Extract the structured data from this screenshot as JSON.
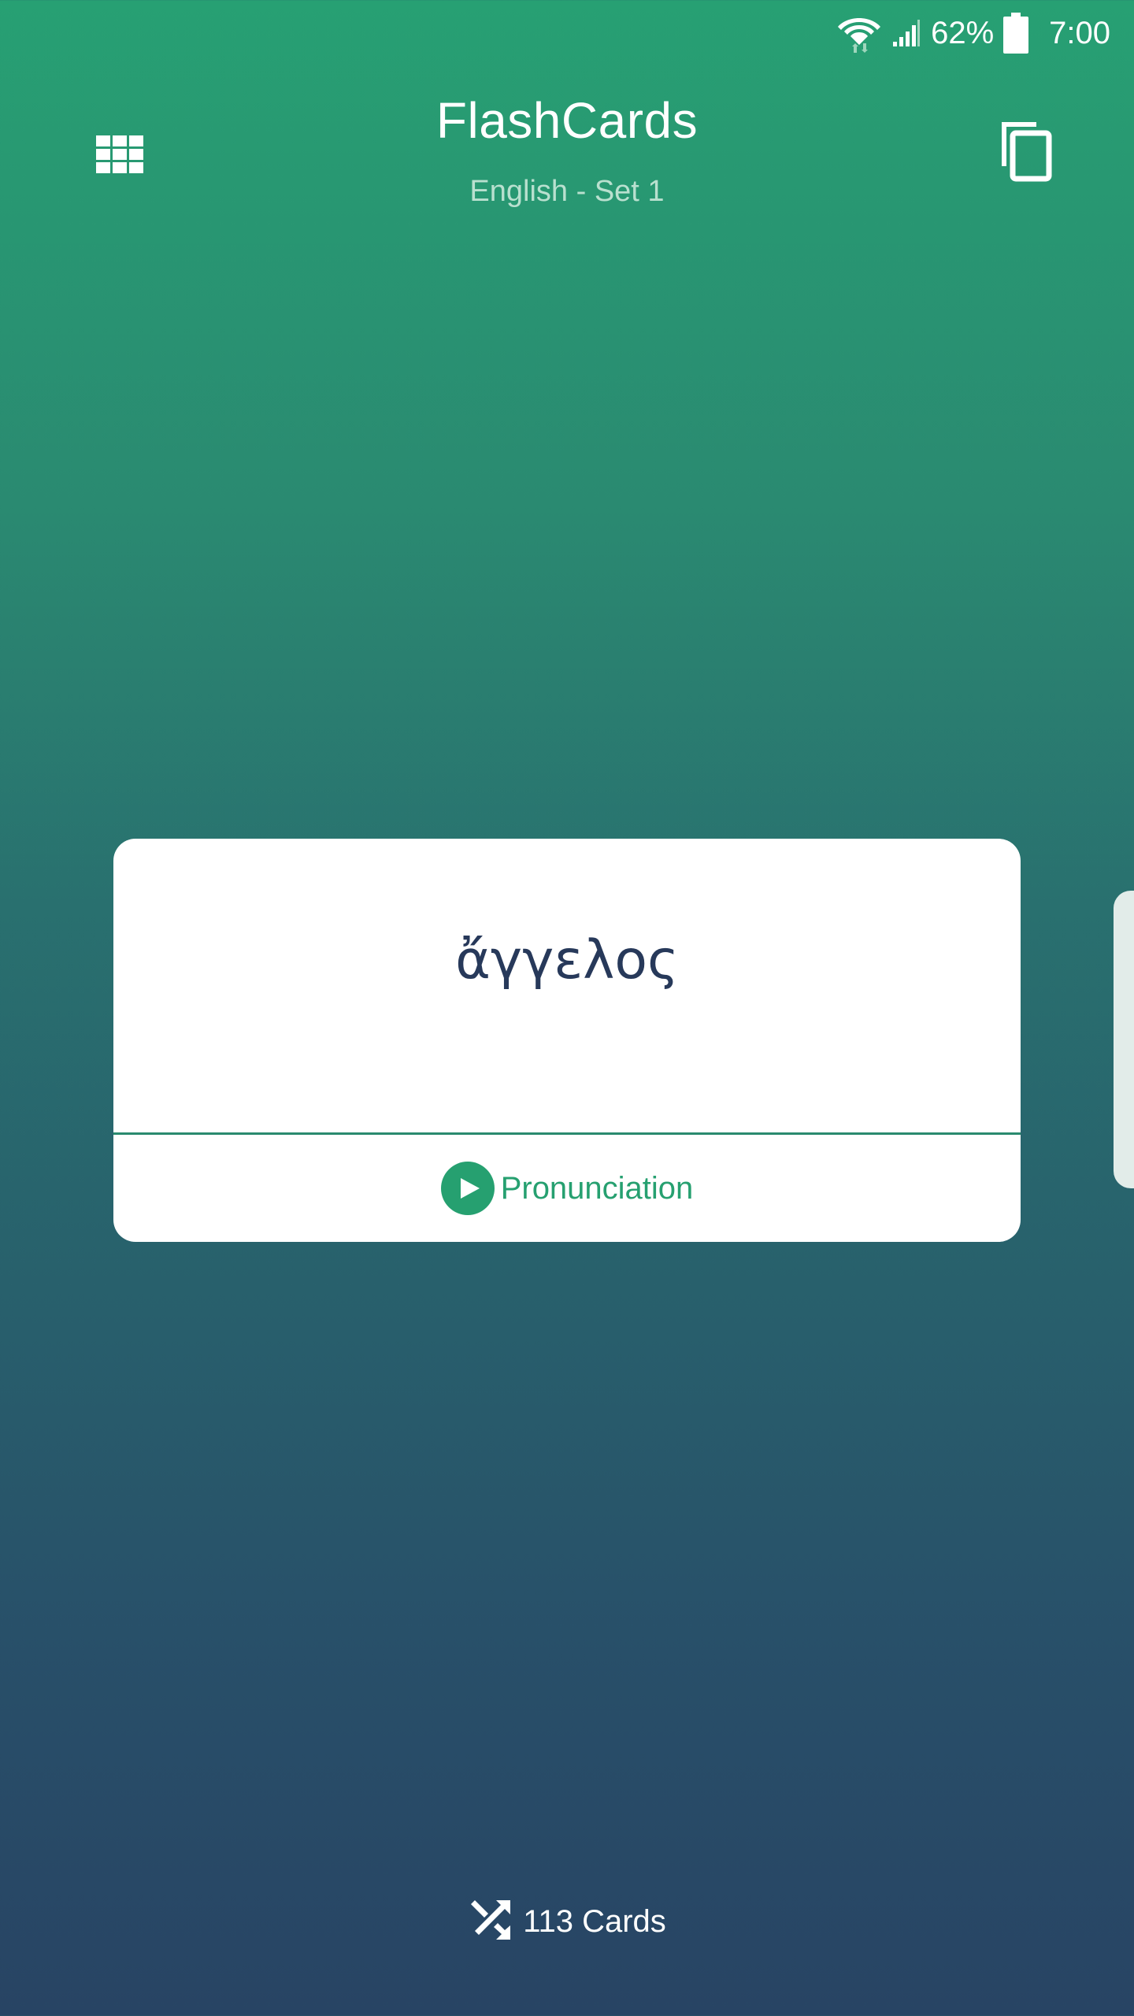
{
  "status_bar": {
    "battery_percent": "62%",
    "time": "7:00",
    "wifi_icon": "wifi-icon",
    "signal_icon": "signal-icon",
    "battery_icon": "battery-icon"
  },
  "header": {
    "title": "FlashCards",
    "subtitle": "English - Set 1",
    "left_icon": "grid-icon",
    "right_icon": "copy-icon"
  },
  "card": {
    "word": "ἄγγελος",
    "pronunciation_label": "Pronunciation",
    "pronunciation_icon": "play-icon"
  },
  "footer": {
    "shuffle_icon": "shuffle-icon",
    "card_count_label": "113 Cards"
  },
  "colors": {
    "accent": "#26a070",
    "gradient_top": "#27a073",
    "gradient_bottom": "#284464",
    "card_text": "#27395a",
    "subtitle": "#b9e0cf"
  }
}
